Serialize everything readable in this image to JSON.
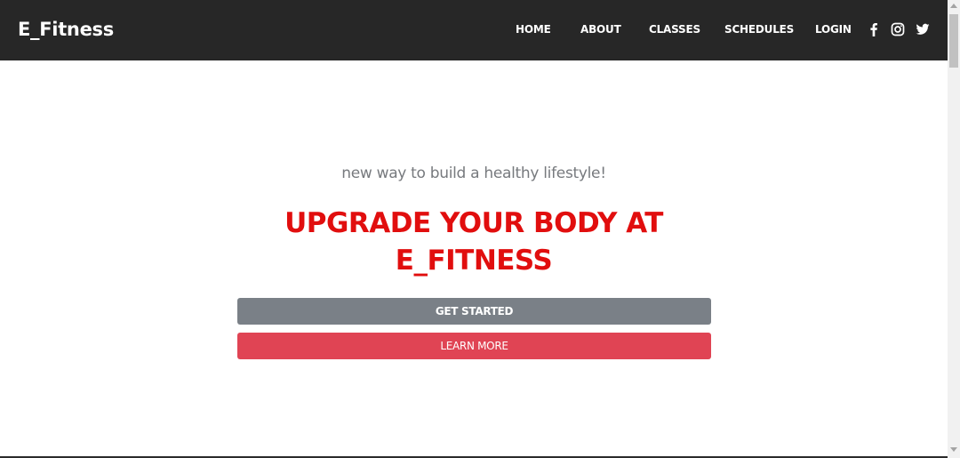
{
  "navbar": {
    "brand": "E_Fitness",
    "links": [
      {
        "label": "HOME"
      },
      {
        "label": "ABOUT"
      },
      {
        "label": "CLASSES"
      },
      {
        "label": "SCHEDULES"
      },
      {
        "label": "LOGIN"
      }
    ],
    "social_icons": [
      "facebook-icon",
      "instagram-icon",
      "twitter-icon"
    ],
    "background_color": "#272727"
  },
  "hero": {
    "tagline": "new way to build a healthy lifestyle!",
    "headline_line1": "UPGRADE YOUR BODY AT",
    "headline_line2": "E_FITNESS",
    "headline_color": "#e10e0e",
    "primary_button": "GET STARTED",
    "primary_button_color": "#7a8087",
    "secondary_button": "LEARN MORE",
    "secondary_button_color": "#e04454"
  }
}
